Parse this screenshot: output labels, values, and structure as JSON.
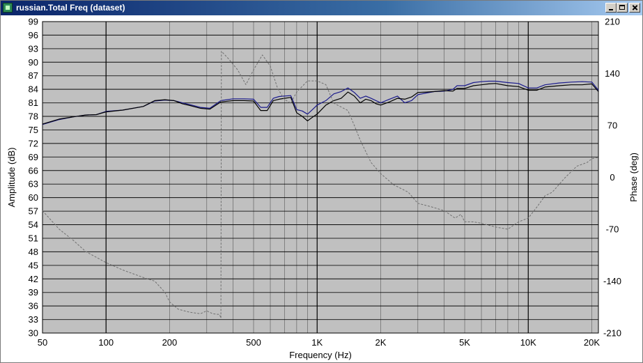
{
  "window": {
    "title": "russian.Total Freq (dataset)",
    "controls": [
      "minimize",
      "maximize",
      "close"
    ]
  },
  "colors": {
    "plot_background": "#c0c0c0",
    "grid": "#000000",
    "series_blue": "#1a1a8c",
    "series_black": "#000000",
    "phase": "#707070"
  },
  "chart_data": {
    "type": "line",
    "xlabel": "Frequency (Hz)",
    "ylabel": "Amplitude (dB)",
    "y2label": "Phase (deg)",
    "x_scale": "log",
    "xlim": [
      50,
      21500
    ],
    "ylim": [
      30,
      99
    ],
    "y2lim": [
      -210,
      210
    ],
    "x_ticks": [
      {
        "value": 50,
        "label": "50"
      },
      {
        "value": 100,
        "label": "100"
      },
      {
        "value": 200,
        "label": "200"
      },
      {
        "value": 500,
        "label": "500"
      },
      {
        "value": 1000,
        "label": "1K"
      },
      {
        "value": 2000,
        "label": "2K"
      },
      {
        "value": 5000,
        "label": "5K"
      },
      {
        "value": 10000,
        "label": "10K"
      },
      {
        "value": 20000,
        "label": "20K"
      }
    ],
    "x_major_grid": [
      100,
      1000,
      10000
    ],
    "x_minor_grid": [
      200,
      300,
      400,
      500,
      600,
      700,
      800,
      900,
      2000,
      3000,
      4000,
      5000,
      6000,
      7000,
      8000,
      9000,
      20000
    ],
    "y_ticks": [
      30,
      33,
      36,
      39,
      42,
      45,
      48,
      51,
      54,
      57,
      60,
      63,
      66,
      69,
      72,
      75,
      78,
      81,
      84,
      87,
      90,
      93,
      96,
      99
    ],
    "y_major_ticks": [
      30,
      36,
      42,
      48,
      54,
      60,
      66,
      72,
      78,
      84,
      90,
      96
    ],
    "y2_ticks": [
      -210,
      -140,
      -70,
      0,
      70,
      140,
      210
    ],
    "grid": true,
    "series": [
      {
        "color": "#1a1a8c",
        "style": "solid",
        "axis": "left",
        "x": [
          50,
          60,
          70,
          80,
          90,
          100,
          120,
          150,
          170,
          190,
          210,
          230,
          250,
          280,
          310,
          350,
          400,
          450,
          500,
          540,
          580,
          620,
          660,
          700,
          750,
          800,
          850,
          900,
          950,
          1000,
          1100,
          1200,
          1300,
          1400,
          1500,
          1600,
          1700,
          1800,
          1900,
          2000,
          2200,
          2400,
          2600,
          2800,
          3000,
          3300,
          3600,
          4000,
          4400,
          4600,
          5000,
          5500,
          6000,
          6500,
          7000,
          8000,
          9000,
          10000,
          11000,
          12000,
          14000,
          16000,
          18000,
          20000,
          21500
        ],
        "y": [
          76.2,
          77.3,
          77.9,
          78.3,
          78.4,
          79.1,
          79.4,
          80.2,
          81.4,
          81.6,
          81.5,
          81.0,
          80.6,
          80.0,
          79.8,
          81.5,
          81.9,
          81.9,
          81.8,
          80.0,
          80.0,
          82.0,
          82.4,
          82.5,
          82.6,
          79.5,
          79.2,
          78.5,
          79.5,
          80.5,
          81.5,
          83.0,
          83.5,
          84.3,
          83.3,
          82.0,
          82.5,
          82.0,
          81.5,
          81.0,
          81.8,
          82.5,
          81.0,
          81.5,
          82.8,
          83.2,
          83.5,
          83.6,
          84.0,
          84.8,
          84.8,
          85.5,
          85.7,
          85.8,
          85.8,
          85.5,
          85.3,
          84.3,
          84.3,
          85.0,
          85.4,
          85.6,
          85.7,
          85.6,
          83.8
        ]
      },
      {
        "color": "#000000",
        "style": "solid",
        "axis": "left",
        "x": [
          50,
          60,
          70,
          80,
          90,
          100,
          120,
          150,
          170,
          190,
          210,
          230,
          250,
          280,
          310,
          350,
          400,
          450,
          500,
          540,
          580,
          620,
          660,
          700,
          750,
          800,
          850,
          900,
          950,
          1000,
          1100,
          1200,
          1300,
          1400,
          1500,
          1600,
          1700,
          1800,
          1900,
          2000,
          2200,
          2400,
          2600,
          2800,
          3000,
          3300,
          3600,
          4000,
          4400,
          4600,
          5000,
          5500,
          6000,
          6500,
          7000,
          8000,
          9000,
          10000,
          11000,
          12000,
          14000,
          16000,
          18000,
          20000,
          21500
        ],
        "y": [
          76.3,
          77.4,
          77.9,
          78.3,
          78.4,
          79.0,
          79.4,
          80.2,
          81.5,
          81.7,
          81.5,
          80.8,
          80.4,
          79.8,
          79.6,
          81.2,
          81.5,
          81.5,
          81.4,
          79.3,
          79.3,
          81.5,
          81.8,
          82.0,
          82.2,
          78.8,
          78.0,
          77.0,
          77.8,
          78.5,
          80.5,
          81.5,
          82.0,
          83.4,
          82.5,
          81.0,
          81.8,
          81.5,
          80.8,
          80.5,
          81.2,
          82.0,
          81.8,
          82.3,
          83.3,
          83.4,
          83.5,
          83.7,
          83.6,
          84.2,
          84.2,
          84.8,
          85.0,
          85.2,
          85.3,
          84.8,
          84.6,
          83.8,
          83.8,
          84.5,
          84.8,
          85.0,
          85.0,
          85.2,
          83.5
        ]
      },
      {
        "color": "#707070",
        "style": "dashed",
        "axis": "right",
        "x": [
          50,
          60,
          70,
          80,
          100,
          120,
          150,
          170,
          190,
          200,
          220,
          250,
          280,
          300,
          320,
          345,
          350,
          352,
          380,
          420,
          460,
          500,
          550,
          600,
          650,
          700,
          750,
          800,
          900,
          1000,
          1100,
          1200,
          1400,
          1500,
          1600,
          1800,
          2000,
          2300,
          2700,
          3000,
          3500,
          4000,
          4500,
          4800,
          5000,
          5500,
          6000,
          7000,
          8000,
          9000,
          10000,
          11000,
          12000,
          13000,
          15000,
          17000,
          19000,
          20000,
          21500
        ],
        "y": [
          -45,
          -70,
          -85,
          -100,
          -115,
          -125,
          -135,
          -140,
          -155,
          -168,
          -178,
          -182,
          -184,
          -180,
          -184,
          -185,
          -190,
          170,
          160,
          145,
          125,
          145,
          165,
          150,
          120,
          105,
          100,
          115,
          130,
          130,
          125,
          100,
          90,
          70,
          50,
          20,
          5,
          -10,
          -20,
          -35,
          -40,
          -45,
          -55,
          -50,
          -60,
          -60,
          -62,
          -67,
          -70,
          -60,
          -55,
          -40,
          -25,
          -20,
          0,
          15,
          20,
          25,
          27
        ]
      }
    ]
  }
}
